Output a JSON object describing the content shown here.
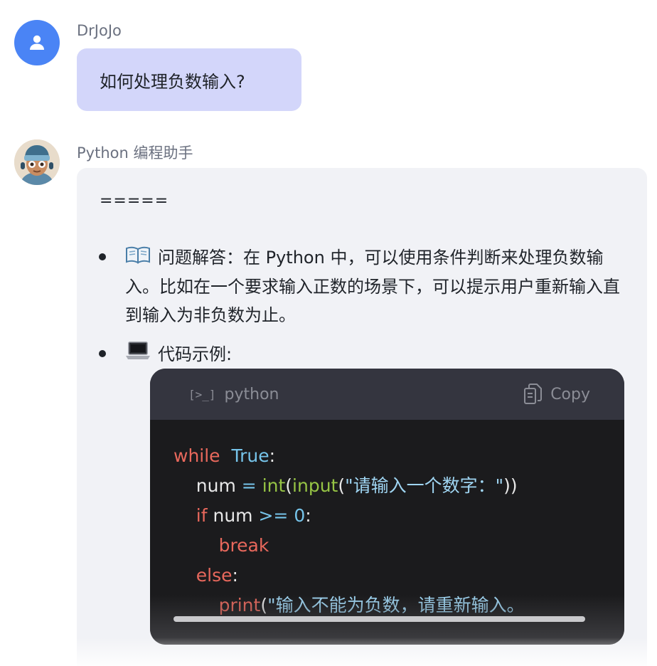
{
  "messages": [
    {
      "sender": "DrJoJo",
      "text": "如何处理负数输入?"
    },
    {
      "sender": "Python 编程助手",
      "separator": "=====",
      "bullets": [
        {
          "icon": "open-book-icon",
          "text": "问题解答：在 Python 中，可以使用条件判断来处理负数输入。比如在一个要求输入正数的场景下，可以提示用户重新输入直到输入为非负数为止。"
        },
        {
          "icon": "laptop-icon",
          "text": "代码示例:"
        }
      ],
      "code": {
        "language": "python",
        "copy_label": "Copy",
        "lines": [
          [
            {
              "t": "while",
              "c": "kw"
            },
            {
              "t": "  ",
              "c": ""
            },
            {
              "t": "True",
              "c": "const"
            },
            {
              "t": ":",
              "c": ""
            }
          ],
          [
            {
              "t": "    num ",
              "c": ""
            },
            {
              "t": "=",
              "c": "op"
            },
            {
              "t": " ",
              "c": ""
            },
            {
              "t": "int",
              "c": "fn"
            },
            {
              "t": "(",
              "c": ""
            },
            {
              "t": "input",
              "c": "fn"
            },
            {
              "t": "(",
              "c": ""
            },
            {
              "t": "\"请输入一个数字：\"",
              "c": "str"
            },
            {
              "t": "))",
              "c": ""
            }
          ],
          [
            {
              "t": "    ",
              "c": ""
            },
            {
              "t": "if",
              "c": "kw"
            },
            {
              "t": " num ",
              "c": ""
            },
            {
              "t": ">=",
              "c": "op"
            },
            {
              "t": " ",
              "c": ""
            },
            {
              "t": "0",
              "c": "const"
            },
            {
              "t": ":",
              "c": ""
            }
          ],
          [
            {
              "t": "        ",
              "c": ""
            },
            {
              "t": "break",
              "c": "kw"
            }
          ],
          [
            {
              "t": "    ",
              "c": ""
            },
            {
              "t": "else",
              "c": "kw"
            },
            {
              "t": ":",
              "c": ""
            }
          ],
          [
            {
              "t": "        ",
              "c": ""
            },
            {
              "t": "print",
              "c": "kw"
            },
            {
              "t": "(",
              "c": ""
            },
            {
              "t": "\"输入不能为负数，请重新输入。",
              "c": "str"
            }
          ]
        ]
      }
    }
  ],
  "colors": {
    "user_bubble": "#d3d6fa",
    "bot_bubble": "#f1f2f6",
    "code_bg": "#1b1b1d",
    "code_header": "#34353f",
    "avatar_user": "#4a84f5"
  }
}
